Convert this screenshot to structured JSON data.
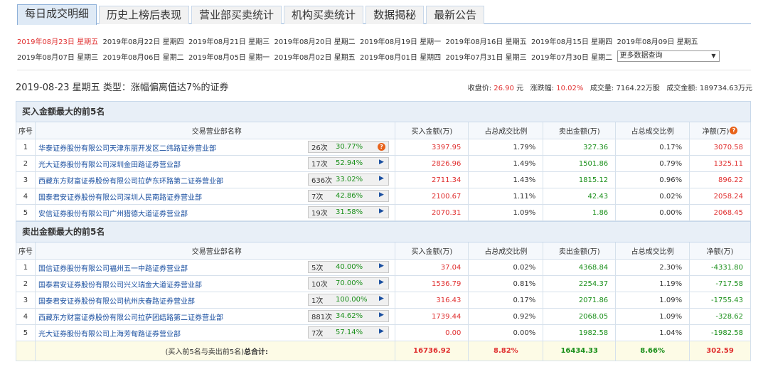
{
  "tabs": [
    "每日成交明细",
    "历史上榜后表现",
    "营业部买卖统计",
    "机构买卖统计",
    "数据揭秘",
    "最新公告"
  ],
  "dates": [
    [
      "2019年08月23日 星期五",
      "2019年08月22日 星期四",
      "2019年08月21日 星期三",
      "2019年08月20日 星期二",
      "2019年08月19日 星期一",
      "2019年08月16日 星期五",
      "2019年08月15日 星期四",
      "2019年08月09日 星期五"
    ],
    [
      "2019年08月07日 星期三",
      "2019年08月06日 星期二",
      "2019年08月05日 星期一",
      "2019年08月02日 星期五",
      "2019年08月01日 星期四",
      "2019年07月31日 星期三",
      "2019年07月30日 星期二"
    ]
  ],
  "more_query": "更多数据查询",
  "info": {
    "title": "2019-08-23 星期五  类型：涨幅偏离值达7%的证券",
    "close_label": "收盘价:",
    "close_value": "26.90",
    "close_unit": "元",
    "change_label": "涨跌幅:",
    "change_value": "10.02%",
    "volume_label": "成交量:",
    "volume_value": "7164.22万股",
    "amount_label": "成交金额:",
    "amount_value": "189734.63万元"
  },
  "headers": [
    "序号",
    "交易营业部名称",
    "买入金额(万)",
    "占总成交比例",
    "卖出金额(万)",
    "占总成交比例",
    "净额(万)",
    "净额(万)"
  ],
  "buy_section": {
    "title": "买入金额最大的前5名",
    "rows": [
      {
        "no": "1",
        "name": "华泰证券股份有限公司天津东丽开发区二纬路证券营业部",
        "cnt": "26次",
        "pct": "30.77%",
        "buy": "3397.95",
        "buy_ratio": "1.79%",
        "sell": "327.36",
        "sell_ratio": "0.17%",
        "net": "3070.58"
      },
      {
        "no": "2",
        "name": "光大证券股份有限公司深圳金田路证券营业部",
        "cnt": "17次",
        "pct": "52.94%",
        "buy": "2826.96",
        "buy_ratio": "1.49%",
        "sell": "1501.86",
        "sell_ratio": "0.79%",
        "net": "1325.11"
      },
      {
        "no": "3",
        "name": "西藏东方财富证券股份有限公司拉萨东环路第二证券营业部",
        "cnt": "636次",
        "pct": "33.02%",
        "buy": "2711.34",
        "buy_ratio": "1.43%",
        "sell": "1815.12",
        "sell_ratio": "0.96%",
        "net": "896.22"
      },
      {
        "no": "4",
        "name": "国泰君安证券股份有限公司深圳人民南路证券营业部",
        "cnt": "7次",
        "pct": "42.86%",
        "buy": "2100.67",
        "buy_ratio": "1.11%",
        "sell": "42.43",
        "sell_ratio": "0.02%",
        "net": "2058.24"
      },
      {
        "no": "5",
        "name": "安信证券股份有限公司广州猎德大道证券营业部",
        "cnt": "19次",
        "pct": "31.58%",
        "buy": "2070.31",
        "buy_ratio": "1.09%",
        "sell": "1.86",
        "sell_ratio": "0.00%",
        "net": "2068.45"
      }
    ]
  },
  "sell_section": {
    "title": "卖出金额最大的前5名",
    "rows": [
      {
        "no": "1",
        "name": "国信证券股份有限公司福州五一中路证券营业部",
        "cnt": "5次",
        "pct": "40.00%",
        "buy": "37.04",
        "buy_ratio": "0.02%",
        "sell": "4368.84",
        "sell_ratio": "2.30%",
        "net": "-4331.80"
      },
      {
        "no": "2",
        "name": "国泰君安证券股份有限公司兴义瑞金大道证券营业部",
        "cnt": "10次",
        "pct": "70.00%",
        "buy": "1536.79",
        "buy_ratio": "0.81%",
        "sell": "2254.37",
        "sell_ratio": "1.19%",
        "net": "-717.58"
      },
      {
        "no": "3",
        "name": "国泰君安证券股份有限公司杭州庆春路证券营业部",
        "cnt": "1次",
        "pct": "100.00%",
        "buy": "316.43",
        "buy_ratio": "0.17%",
        "sell": "2071.86",
        "sell_ratio": "1.09%",
        "net": "-1755.43"
      },
      {
        "no": "4",
        "name": "西藏东方财富证券股份有限公司拉萨团结路第二证券营业部",
        "cnt": "881次",
        "pct": "34.62%",
        "buy": "1739.44",
        "buy_ratio": "0.92%",
        "sell": "2068.05",
        "sell_ratio": "1.09%",
        "net": "-328.62"
      },
      {
        "no": "5",
        "name": "光大证券股份有限公司上海芳甸路证券营业部",
        "cnt": "7次",
        "pct": "57.14%",
        "buy": "0.00",
        "buy_ratio": "0.00%",
        "sell": "1982.58",
        "sell_ratio": "1.04%",
        "net": "-1982.58"
      }
    ]
  },
  "total": {
    "label_a": "(买入前5名与卖出前5名)",
    "label_b": "总合计:",
    "buy": "16736.92",
    "buy_ratio": "8.82%",
    "sell": "16434.33",
    "sell_ratio": "8.66%",
    "net": "302.59"
  },
  "help_glyph": "?",
  "play_glyph": "▶",
  "dropdown_glyph": "▼",
  "colors": {
    "red": "#e03030",
    "green": "#1a8f1a",
    "link": "#1a4fa0",
    "header_bg": "#e8eff7",
    "total_bg": "#fdfbe6",
    "help": "#e8621a"
  }
}
